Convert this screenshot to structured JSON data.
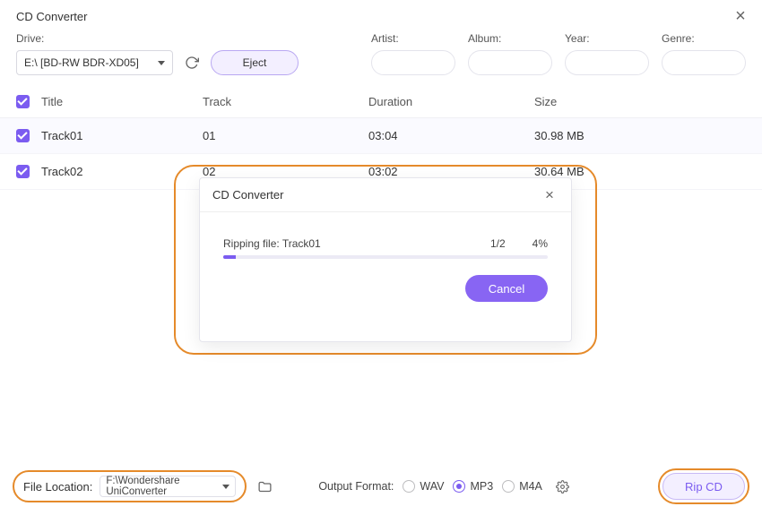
{
  "window": {
    "title": "CD Converter"
  },
  "labels": {
    "drive": "Drive:",
    "artist": "Artist:",
    "album": "Album:",
    "year": "Year:",
    "genre": "Genre:",
    "eject": "Eject",
    "file_location": "File Location:",
    "output_format": "Output Format:",
    "rip_cd": "Rip CD"
  },
  "drive": {
    "selected": "E:\\ [BD-RW  BDR-XD05]"
  },
  "columns": {
    "title": "Title",
    "track": "Track",
    "duration": "Duration",
    "size": "Size"
  },
  "tracks": [
    {
      "checked": true,
      "title": "Track01",
      "track": "01",
      "duration": "03:04",
      "size": "30.98 MB"
    },
    {
      "checked": true,
      "title": "Track02",
      "track": "02",
      "duration": "03:02",
      "size": "30.64 MB"
    }
  ],
  "modal": {
    "title": "CD Converter",
    "ripping_label": "Ripping file: Track01",
    "count": "1/2",
    "percent": "4%",
    "progress_pct": 4,
    "cancel": "Cancel"
  },
  "file_location": {
    "path": "F:\\Wondershare UniConverter"
  },
  "formats": {
    "wav": "WAV",
    "mp3": "MP3",
    "m4a": "M4A",
    "selected": "mp3"
  }
}
